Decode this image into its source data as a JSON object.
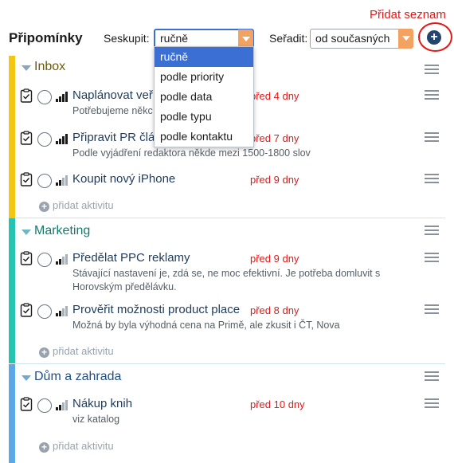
{
  "annotation": {
    "label": "Přidat seznam"
  },
  "header": {
    "title": "Připomínky",
    "group_label": "Seskupit:",
    "group_value": "ručně",
    "sort_label": "Seřadit:",
    "sort_value": "od současných",
    "add_list_icon": "plus-circle-icon"
  },
  "dropdown": {
    "options": [
      "ručně",
      "podle priority",
      "podle data",
      "podle typu",
      "podle kontaktu"
    ],
    "selected": "ručně"
  },
  "add_activity_label": "přidat aktivitu",
  "groups": [
    {
      "name": "Inbox",
      "color": "#f3c613",
      "title_color": "#6b5a0c",
      "tasks": [
        {
          "title": "Naplánovat veř",
          "date": "před 4 dny",
          "description": "Potřebujeme někc"
        },
        {
          "title": "Připravit PR člá",
          "date": "před 7 dny",
          "description": "Podle vyjádření redaktora někde mezi 1500-1800 slov"
        },
        {
          "title": "Koupit nový iPhone",
          "date": "před 9 dny",
          "description": ""
        }
      ]
    },
    {
      "name": "Marketing",
      "color": "#26c4b0",
      "title_color": "#147a6e",
      "tasks": [
        {
          "title": "Předělat PPC reklamy",
          "date": "před 9 dny",
          "description": "Stávající nastavení je, zdá se, ne moc efektivní. Je potřeba domluvit s Horovským předělávku."
        },
        {
          "title": "Prověřit možnosti product place",
          "date": "před 8 dny",
          "description": "Možná by byla výhodná cena na Primě, ale zkusit i ČT, Nova"
        }
      ]
    },
    {
      "name": "Dům a zahrada",
      "color": "#5aa9e6",
      "title_color": "#1f4f86",
      "tasks": [
        {
          "title": "Nákup knih",
          "date": "před 10 dny",
          "description": "viz katalog"
        }
      ]
    }
  ]
}
